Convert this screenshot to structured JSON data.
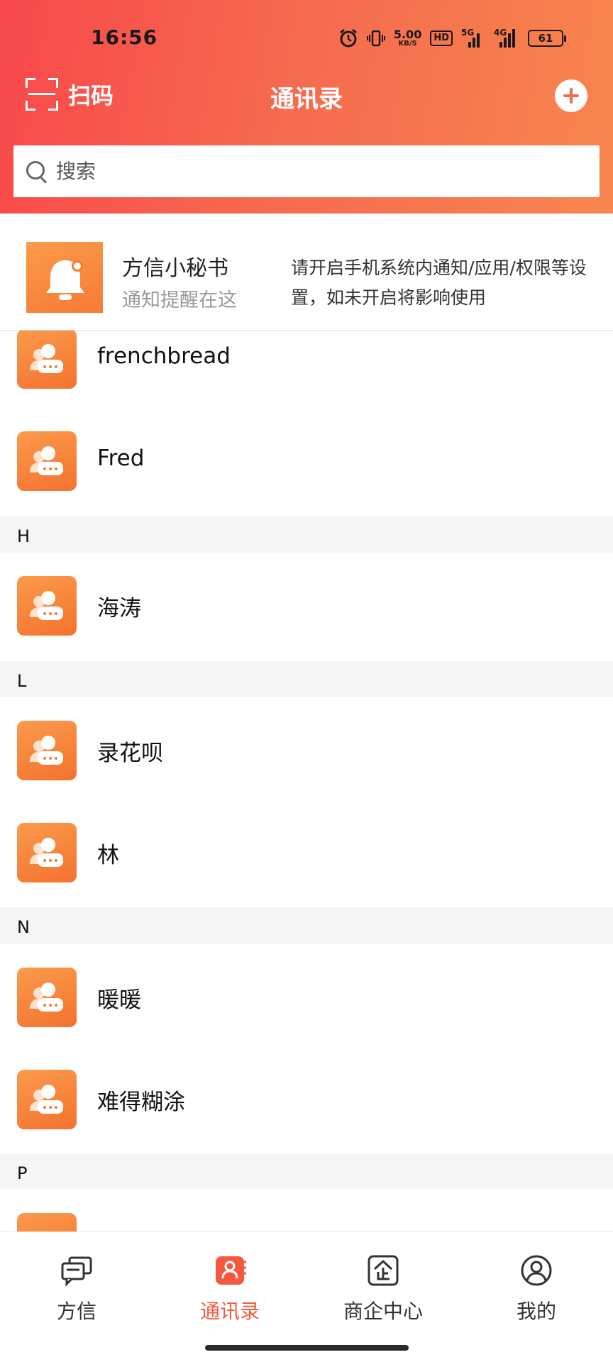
{
  "status": {
    "time": "16:56",
    "net_speed": "5.00",
    "net_unit": "KB/S",
    "hd": "HD",
    "sig1": "5G",
    "sig2": "4G",
    "battery": "61"
  },
  "topbar": {
    "scan_label": "扫码",
    "title": "通讯录"
  },
  "search": {
    "placeholder": "搜索"
  },
  "notice": {
    "title": "方信小秘书",
    "subtitle": "通知提醒在这",
    "message": "请开启手机系统内通知/应用/权限等设置，如未开启将影响使用"
  },
  "contacts": {
    "c1": "frenchbread",
    "c2": "Fred",
    "sec_h": "H",
    "c3": "海涛",
    "sec_l": "L",
    "c4": "录花呗",
    "c5": "林",
    "sec_n": "N",
    "c6": "暖暖",
    "c7": "难得糊涂",
    "sec_p": "P"
  },
  "nav": {
    "tab1": "方信",
    "tab2": "通讯录",
    "tab3": "商企中心",
    "tab4": "我的"
  },
  "colors": {
    "accent": "#f4593e",
    "header_start": "#f8484b",
    "header_end": "#f7864e",
    "avatar": "#f77a35"
  }
}
